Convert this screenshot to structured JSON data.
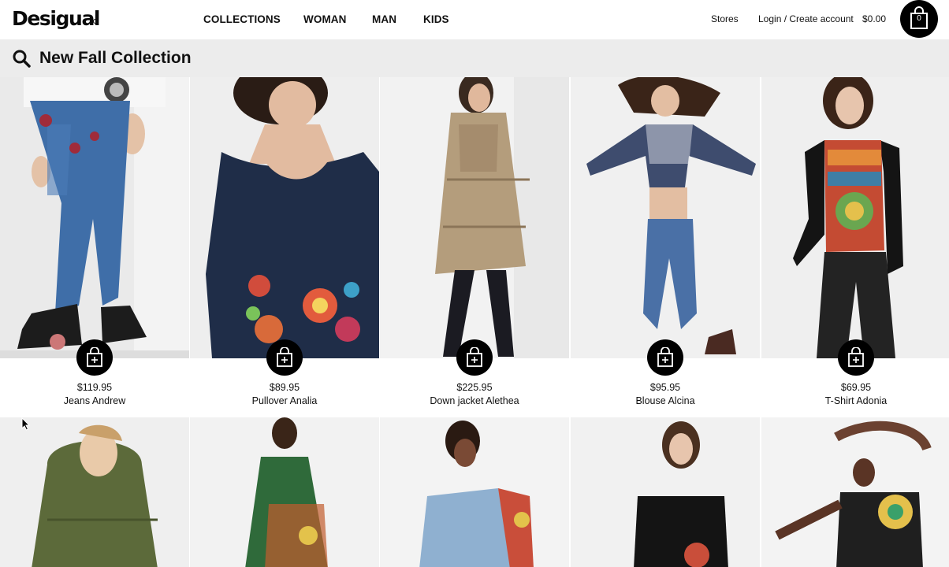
{
  "brand": {
    "logo": "Desigual"
  },
  "nav": [
    {
      "label": "COLLECTIONS"
    },
    {
      "label": "WOMAN"
    },
    {
      "label": "MAN"
    },
    {
      "label": "KIDS"
    }
  ],
  "utility": {
    "stores": "Stores",
    "login": "Login / Create account",
    "cart_total": "$0.00",
    "cart_count": "0"
  },
  "search": {
    "title": "New Fall Collection",
    "icon": "search-icon"
  },
  "products": [
    {
      "price": "$119.95",
      "name": "Jeans Andrew"
    },
    {
      "price": "$89.95",
      "name": "Pullover Analia"
    },
    {
      "price": "$225.95",
      "name": "Down jacket Alethea"
    },
    {
      "price": "$95.95",
      "name": "Blouse Alcina"
    },
    {
      "price": "$69.95",
      "name": "T-Shirt Adonia"
    }
  ],
  "colors": {
    "accent": "#000000",
    "searchbar_bg": "#ececec"
  }
}
